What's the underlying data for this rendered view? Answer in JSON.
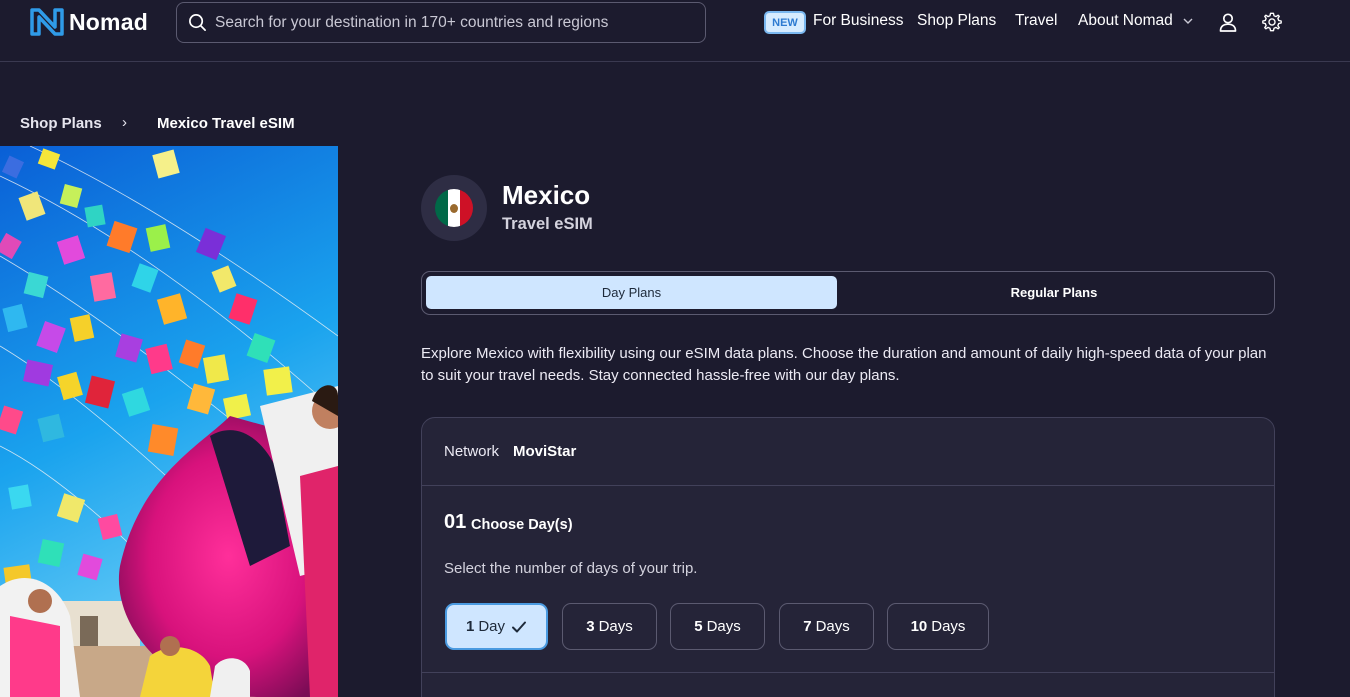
{
  "header": {
    "brand": "Nomad",
    "search_placeholder": "Search for your destination in 170+ countries and regions",
    "new_badge": "NEW",
    "nav": {
      "for_business": "For Business",
      "shop_plans": "Shop Plans",
      "travel": "Travel",
      "about": "About Nomad"
    },
    "icons": [
      "search-icon",
      "user-icon",
      "gear-icon",
      "chevron-down-icon"
    ]
  },
  "breadcrumb": {
    "parent": "Shop Plans",
    "separator": "›",
    "current": "Mexico Travel eSIM"
  },
  "product": {
    "country": "Mexico",
    "subtitle": "Travel eSIM",
    "flag_colors": [
      "#006847",
      "#ffffff",
      "#ce1126"
    ]
  },
  "plan_tabs": {
    "day": "Day Plans",
    "regular": "Regular Plans",
    "selected": "Day Plans"
  },
  "description": "Explore Mexico with flexibility using our eSIM data plans. Choose the duration and amount of daily high-speed data of your plan to suit your travel needs. Stay connected hassle-free with our day plans.",
  "config": {
    "network_label": "Network",
    "network_value": "MoviStar",
    "step_number": "01",
    "step_title": "Choose Day(s)",
    "step_hint": "Select the number of days of your trip.",
    "days": [
      {
        "num": "1",
        "unit": "Day",
        "selected": true
      },
      {
        "num": "3",
        "unit": "Days",
        "selected": false
      },
      {
        "num": "5",
        "unit": "Days",
        "selected": false
      },
      {
        "num": "7",
        "unit": "Days",
        "selected": false
      },
      {
        "num": "10",
        "unit": "Days",
        "selected": false
      }
    ]
  },
  "colors": {
    "background": "#1c1b2e",
    "card": "#252438",
    "accent_light": "#cfe6ff",
    "accent_border": "#4a9ae0"
  }
}
